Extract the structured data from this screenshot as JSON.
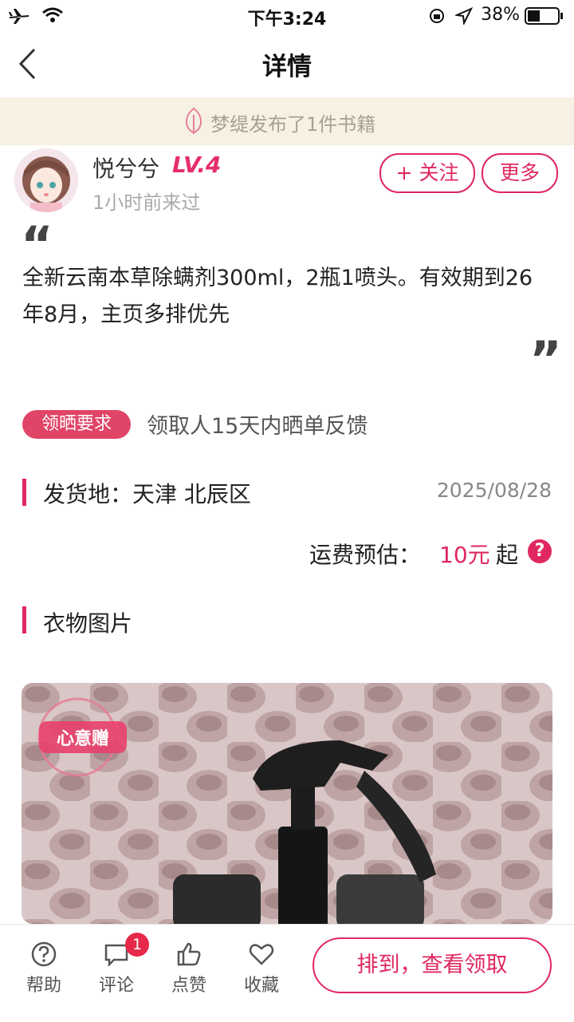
{
  "status_bar": {
    "time": "下午3:24",
    "battery": "38%"
  },
  "nav": {
    "title": "详情"
  },
  "banner": {
    "text": "梦缇发布了1件书籍"
  },
  "user": {
    "name": "悦兮兮",
    "level": "LV.4",
    "last_seen": "1小时前来过",
    "follow_label": "+ 关注",
    "more_label": "更多"
  },
  "post": {
    "quote_open": "“",
    "quote_close": "”",
    "description": "全新云南本草除螨剂300ml，2瓶1喷头。有效期到26年8月，主页多排优先"
  },
  "requirement": {
    "badge": "领晒要求",
    "text": "领取人15天内晒单反馈"
  },
  "shipping": {
    "label": "发货地：天津 北辰区",
    "date": "2025/08/28",
    "freight_label": "运费预估：",
    "freight_value": "10元",
    "freight_suffix": "起",
    "help_symbol": "?"
  },
  "photos": {
    "section_title": "衣物图片",
    "stamp_text": "心意赠"
  },
  "bottom_bar": {
    "tabs": [
      {
        "label": "帮助",
        "icon": "help-icon"
      },
      {
        "label": "评论",
        "icon": "comment-icon",
        "badge": "1"
      },
      {
        "label": "点赞",
        "icon": "like-icon"
      },
      {
        "label": "收藏",
        "icon": "favorite-icon"
      }
    ],
    "cta_label": "排到，查看领取"
  },
  "colors": {
    "accent": "#e0275f",
    "banner_bg": "#f6f1e3",
    "badge_red": "#e6294b"
  }
}
